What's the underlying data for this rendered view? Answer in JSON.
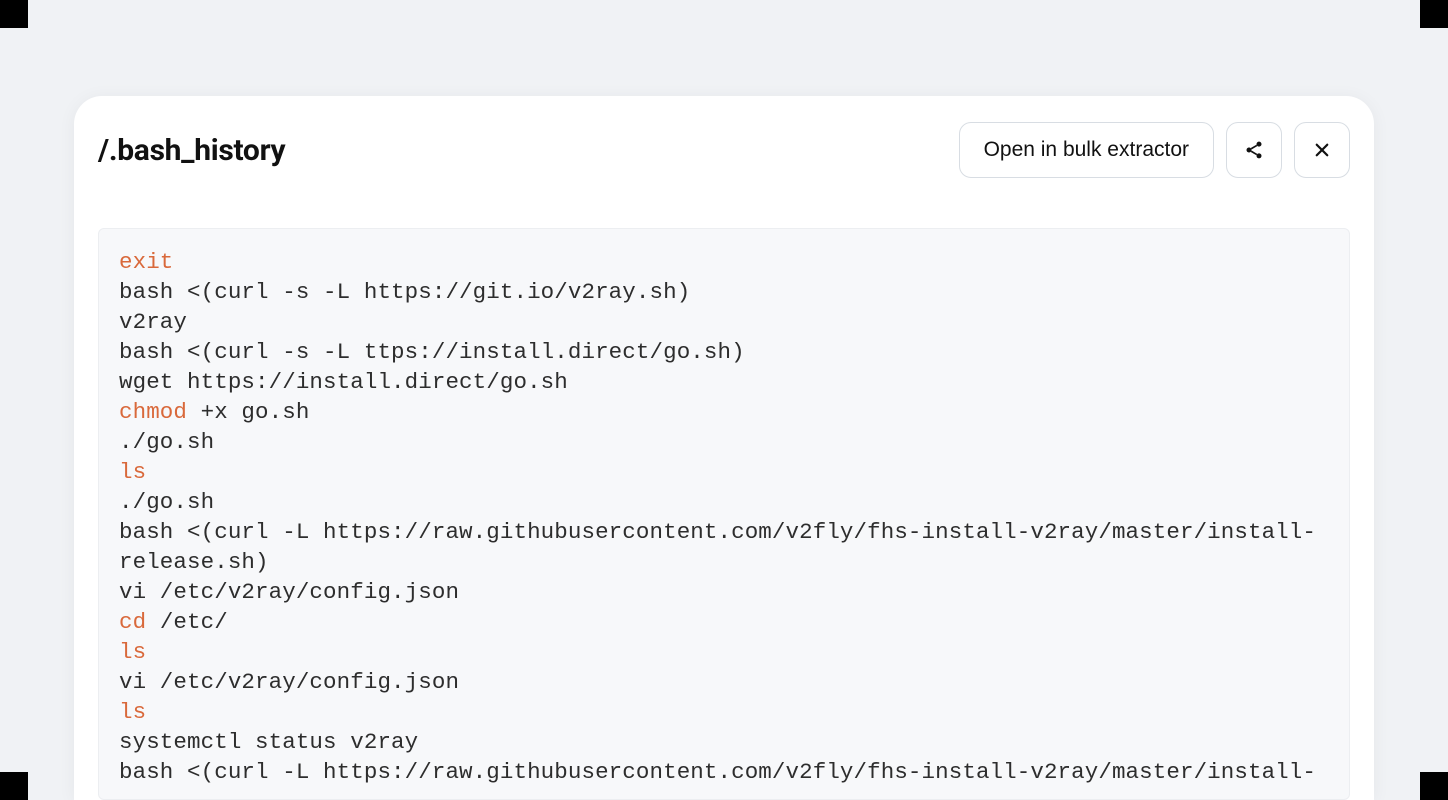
{
  "header": {
    "title": "/.bash_history",
    "open_button_label": "Open in bulk extractor"
  },
  "code": {
    "highlighted_commands": [
      "exit",
      "chmod",
      "ls",
      "cd"
    ],
    "lines": [
      {
        "text": "exit",
        "hl": true
      },
      {
        "text": "bash <(curl -s -L https://git.io/v2ray.sh)"
      },
      {
        "text": "v2ray"
      },
      {
        "text": "bash <(curl -s -L ttps://install.direct/go.sh)"
      },
      {
        "text": "wget https://install.direct/go.sh"
      },
      {
        "prefix": "chmod",
        "text": " +x go.sh",
        "hl_prefix": true
      },
      {
        "text": "./go.sh"
      },
      {
        "text": "ls",
        "hl": true
      },
      {
        "text": "./go.sh"
      },
      {
        "text": "bash <(curl -L https://raw.githubusercontent.com/v2fly/fhs-install-v2ray/master/install-release.sh)"
      },
      {
        "text": "vi /etc/v2ray/config.json"
      },
      {
        "prefix": "cd",
        "text": " /etc/",
        "hl_prefix": true
      },
      {
        "text": "ls",
        "hl": true
      },
      {
        "text": "vi /etc/v2ray/config.json"
      },
      {
        "text": "ls",
        "hl": true
      },
      {
        "text": "systemctl status v2ray"
      },
      {
        "text": "bash <(curl -L https://raw.githubusercontent.com/v2fly/fhs-install-v2ray/master/install-"
      }
    ]
  }
}
